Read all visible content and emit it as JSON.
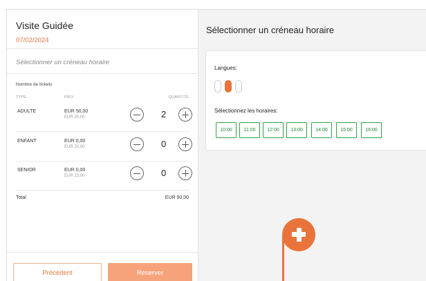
{
  "event": {
    "title": "Visite Guidée",
    "date": "07/02/2024"
  },
  "left_panel": {
    "slot_hint": "Sélectionner un créneau horaire",
    "tickets_label": "Nombre de tickets",
    "columns": {
      "type": "TYPE",
      "price": "PRIX",
      "quantity": "QUANTITÉ"
    },
    "rows": [
      {
        "type": "ADULTE",
        "price": "EUR 50,00",
        "sub": "EUR 25,00",
        "qty": "2"
      },
      {
        "type": "ENFANT",
        "price": "EUR 0,00",
        "sub": "EUR 20,00",
        "qty": "0"
      },
      {
        "type": "SENIOR",
        "price": "EUR 0,00",
        "sub": "EUR 23,00",
        "qty": "0"
      }
    ],
    "total_label": "Total",
    "total_value": "EUR 50,00",
    "prev_button": "Précédent",
    "book_button": "Réserver"
  },
  "right_panel": {
    "title": "Sélectionner un créneau horaire",
    "languages_label": "Langues:",
    "language_options": [
      {
        "active": false
      },
      {
        "active": true
      },
      {
        "active": false
      }
    ],
    "hours_label": "Sélectionnez les horaires:",
    "slots": [
      "10:00",
      "11:00",
      "12:00",
      "13:00",
      "14:00",
      "15:00",
      "16:00"
    ]
  },
  "colors": {
    "accent": "#e8743b",
    "slot_green": "#2aa146",
    "panel_bg": "#f3f3f3"
  },
  "icons": {
    "fab": "plus-icon",
    "stepper_minus": "minus-circle-icon",
    "stepper_plus": "plus-circle-icon"
  }
}
